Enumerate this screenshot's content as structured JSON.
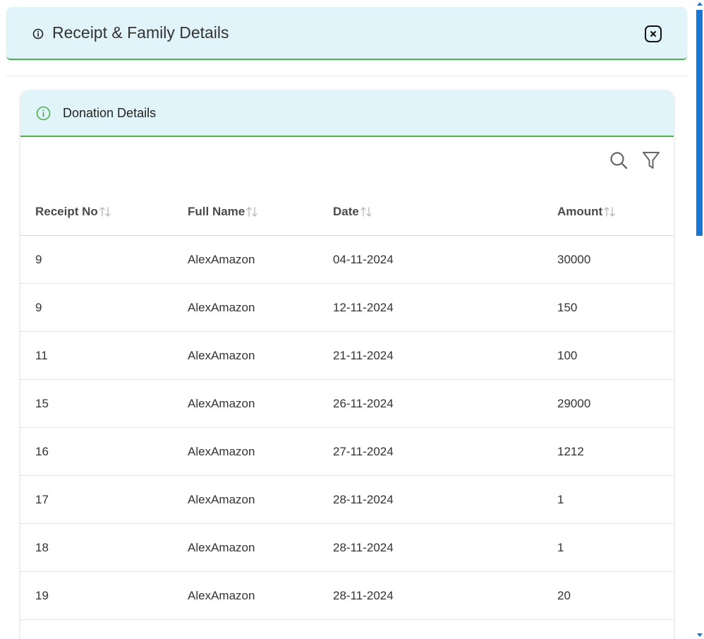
{
  "modal": {
    "title": "Receipt & Family Details",
    "close_icon": "close-icon",
    "info_icon": "info-icon"
  },
  "card": {
    "title": "Donation Details",
    "info_icon": "info-circle-icon",
    "toolbar": {
      "search_icon": "search-icon",
      "filter_icon": "filter-icon"
    }
  },
  "table": {
    "columns": [
      "Receipt No",
      "Full Name",
      "Date",
      "Amount"
    ],
    "rows": [
      [
        "9",
        "AlexAmazon",
        "04-11-2024",
        "30000"
      ],
      [
        "9",
        "AlexAmazon",
        "12-11-2024",
        "150"
      ],
      [
        "11",
        "AlexAmazon",
        "21-11-2024",
        "100"
      ],
      [
        "15",
        "AlexAmazon",
        "26-11-2024",
        "29000"
      ],
      [
        "16",
        "AlexAmazon",
        "27-11-2024",
        "1212"
      ],
      [
        "17",
        "AlexAmazon",
        "28-11-2024",
        "1"
      ],
      [
        "18",
        "AlexAmazon",
        "28-11-2024",
        "1"
      ],
      [
        "19",
        "AlexAmazon",
        "28-11-2024",
        "20"
      ],
      [
        "",
        "",
        "",
        ""
      ]
    ]
  },
  "colors": {
    "header_bg": "#e1f4f9",
    "accent_green": "#4caf50",
    "scrollbar": "#1976d2"
  }
}
